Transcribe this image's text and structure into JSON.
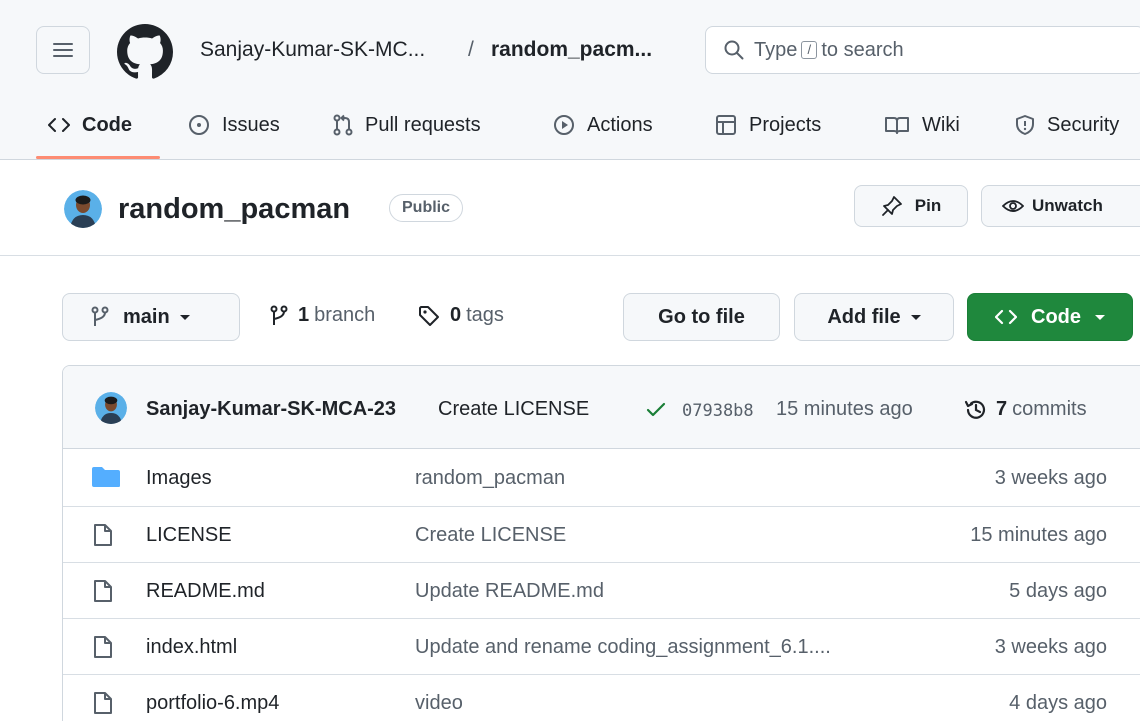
{
  "header": {
    "owner": "Sanjay-Kumar-SK-MC...",
    "separator": "/",
    "repo": "random_pacm...",
    "search": {
      "prefix": "Type",
      "key": "/",
      "suffix": "to search"
    }
  },
  "nav": {
    "tabs": [
      {
        "label": "Code",
        "icon": "code-icon",
        "selected": true
      },
      {
        "label": "Issues",
        "icon": "issue-circle-icon"
      },
      {
        "label": "Pull requests",
        "icon": "pull-request-icon"
      },
      {
        "label": "Actions",
        "icon": "play-icon"
      },
      {
        "label": "Projects",
        "icon": "table-icon"
      },
      {
        "label": "Wiki",
        "icon": "book-icon"
      },
      {
        "label": "Security",
        "icon": "shield-icon"
      }
    ]
  },
  "repo": {
    "name": "random_pacman",
    "visibility": "Public",
    "pin_label": "Pin",
    "unwatch_label": "Unwatch"
  },
  "toolbar": {
    "branch": "main",
    "branch_count": "1",
    "branch_label": "branch",
    "tag_count": "0",
    "tag_label": "tags",
    "go_to_file": "Go to file",
    "add_file": "Add file",
    "code": "Code"
  },
  "commit": {
    "author": "Sanjay-Kumar-SK-MCA-23",
    "message": "Create LICENSE",
    "sha": "07938b8",
    "time": "15 minutes ago",
    "commits_count": "7",
    "commits_label": "commits"
  },
  "files": [
    {
      "name": "Images",
      "type": "folder",
      "commit": "random_pacman",
      "age": "3 weeks ago"
    },
    {
      "name": "LICENSE",
      "type": "file",
      "commit": "Create LICENSE",
      "age": "15 minutes ago"
    },
    {
      "name": "README.md",
      "type": "file",
      "commit": "Update README.md",
      "age": "5 days ago"
    },
    {
      "name": "index.html",
      "type": "file",
      "commit": "Update and rename coding_assignment_6.1....",
      "age": "3 weeks ago"
    },
    {
      "name": "portfolio-6.mp4",
      "type": "file",
      "commit": "video",
      "age": "4 days ago"
    }
  ],
  "colors": {
    "accent_underline": "#fd8c73",
    "primary_button": "#1f883d",
    "folder": "#54aeff",
    "check": "#1a7f37"
  }
}
